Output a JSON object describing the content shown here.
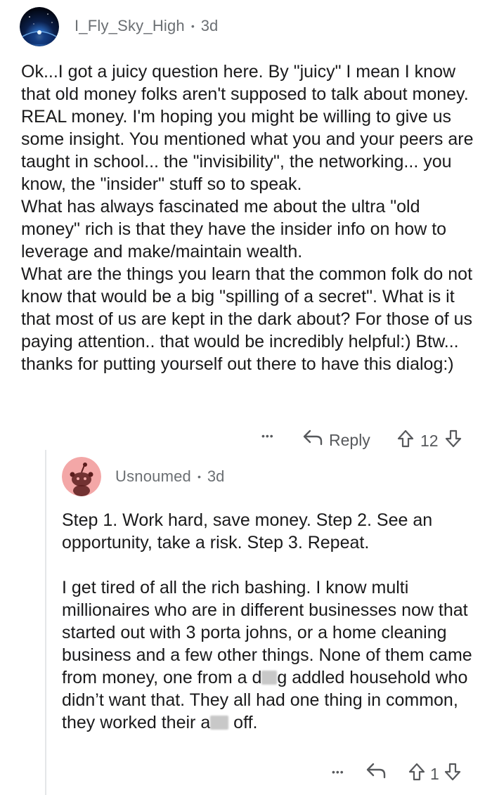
{
  "comment1": {
    "username": "I_Fly_Sky_High",
    "separator": "•",
    "age": "3d",
    "paragraphs": [
      "Ok...I got a juicy question here. By \"juicy\" I mean I know that old money folks aren't supposed to talk about money. REAL money.  I'm hoping you might be willing to give us some insight. You mentioned what you and your peers are taught in school... the \"invisibility\", the networking... you know, the \"insider\" stuff so to speak.",
      "What has always fascinated me about the ultra \"old money\" rich is that they have the insider info on how to leverage and make/maintain wealth.",
      "What are the things you learn that the common folk do not know that would be a big \"spilling of a secret\".   What is it that most of us are kept in the dark about? For those of us paying attention.. that would be incredibly helpful:) Btw... thanks for putting yourself out there to have this dialog:)"
    ],
    "actions": {
      "more": "•••",
      "reply_label": "Reply",
      "score": "12"
    }
  },
  "comment2": {
    "username": "Usnoumed",
    "separator": "•",
    "age": "3d",
    "para1": "Step 1.  Work hard, save money. Step 2.  See an opportunity, take a risk. Step 3. Repeat.",
    "para2_a": "I get tired of all the rich bashing.  I know multi millionaires who are in different businesses now that started out with 3 porta johns, or a home cleaning business and a few other things.  None of them came from money, one from a d",
    "para2_b": "g addled household who didn’t want that.  They all had one thing in common, they worked their a",
    "para2_c": " off.",
    "actions": {
      "more": "•••",
      "score": "1"
    }
  },
  "icons": {
    "comment1_avatar": "space-avatar-icon",
    "comment2_avatar": "snoo-avatar-icon",
    "reply": "reply-arrow-icon",
    "upvote": "upvote-arrow-icon",
    "downvote": "downvote-arrow-icon"
  }
}
